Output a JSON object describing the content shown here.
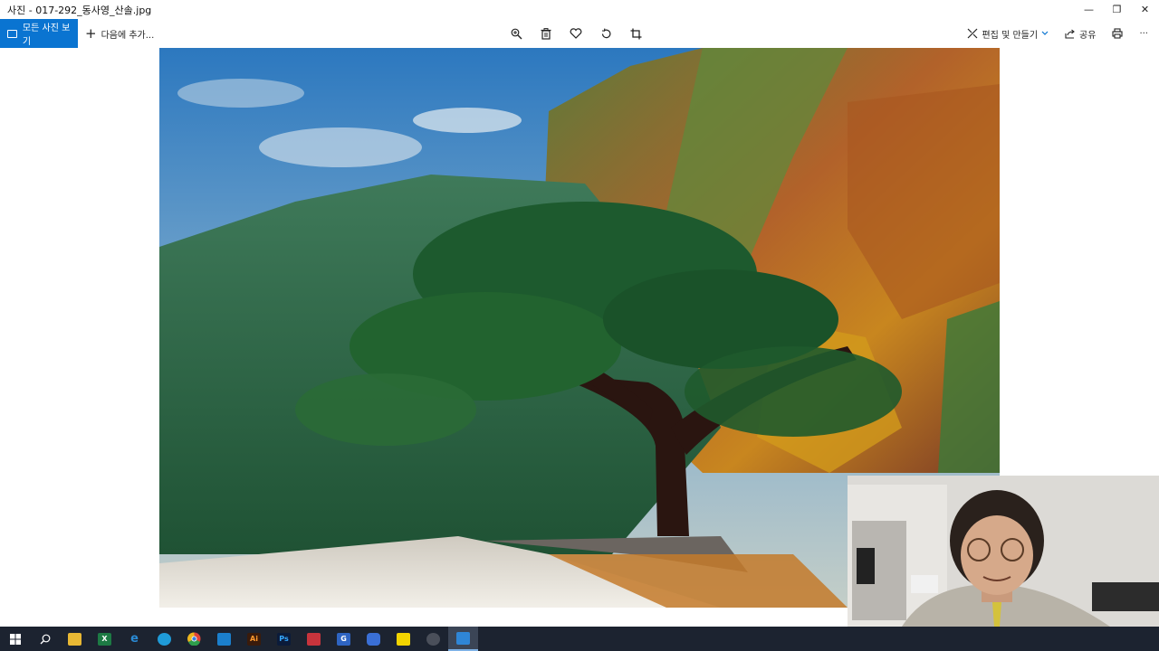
{
  "window": {
    "title": "사진 - 017-292_동사영_산솔.jpg",
    "minimize_glyph": "—",
    "restore_glyph": "❐",
    "close_glyph": "✕"
  },
  "toolbar": {
    "all_photos_label": "모든 사진 보기",
    "add_to_label": "다음에 추가...",
    "add_glyph": "+",
    "edit_create_label": "편집 및 만들기",
    "share_label": "공유",
    "more_glyph": "···"
  },
  "image": {
    "description_icons": [
      "zoom-icon",
      "delete-icon",
      "favorite-icon",
      "rotate-icon",
      "crop-icon"
    ]
  },
  "taskbar": {
    "apps": [
      {
        "name": "start",
        "icon": "windows-icon"
      },
      {
        "name": "search",
        "icon": "search-icon"
      },
      {
        "name": "file-explorer",
        "icon": "folder-icon",
        "color": "#e8b834"
      },
      {
        "name": "excel",
        "icon": "excel-icon",
        "color": "#1d7a44",
        "glyph": "X"
      },
      {
        "name": "ie",
        "icon": "ie-icon",
        "color": "#2a8ad4",
        "glyph": "e"
      },
      {
        "name": "edge",
        "icon": "edge-icon",
        "color": "#1f9bd8"
      },
      {
        "name": "chrome",
        "icon": "chrome-icon",
        "color": "#e0453a"
      },
      {
        "name": "app-blue",
        "icon": "app-icon",
        "color": "#1b7fcc"
      },
      {
        "name": "illustrator",
        "icon": "illustrator-icon",
        "color": "#3a1b0b",
        "glyph": "Ai"
      },
      {
        "name": "photoshop",
        "icon": "photoshop-icon",
        "color": "#0b1b3a",
        "glyph": "Ps"
      },
      {
        "name": "app-red",
        "icon": "app-icon",
        "color": "#c8343c"
      },
      {
        "name": "app-g",
        "icon": "app-icon",
        "color": "#2e64c2",
        "glyph": "G"
      },
      {
        "name": "app-cube",
        "icon": "app-icon",
        "color": "#3a6fd6"
      },
      {
        "name": "kakaotalk",
        "icon": "chat-icon",
        "color": "#f2d400"
      },
      {
        "name": "app-circle",
        "icon": "app-icon",
        "color": "#4a4f5a"
      },
      {
        "name": "photos",
        "icon": "photos-icon",
        "color": "#2f86d6",
        "active": true
      }
    ]
  },
  "colors": {
    "accent": "#0a74d1",
    "taskbar": "#1c2330"
  }
}
